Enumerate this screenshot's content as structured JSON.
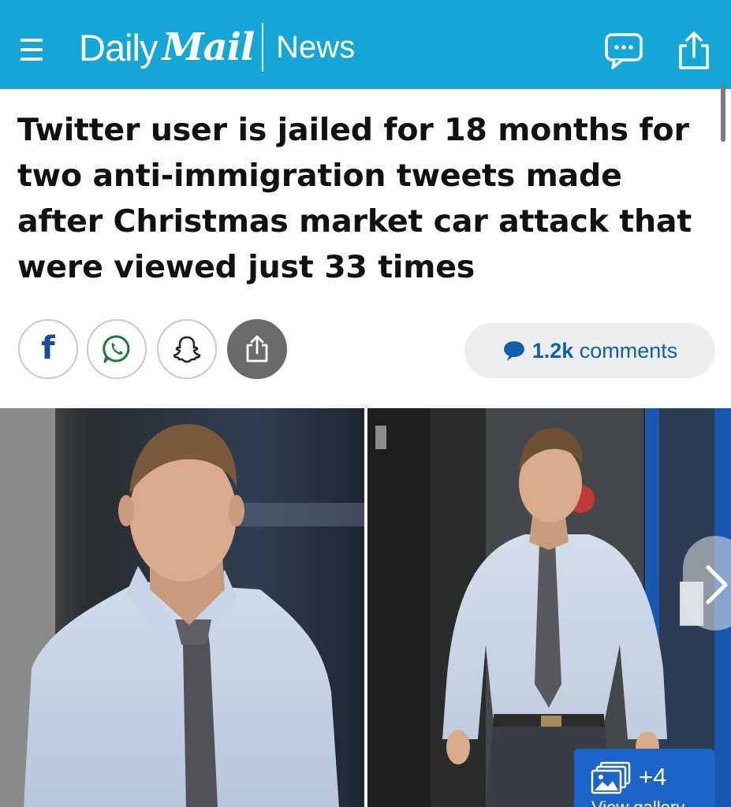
{
  "header": {
    "brand_daily": "Daily",
    "brand_mail": "Mail",
    "section": "News",
    "background": "#13a6d6"
  },
  "article": {
    "headline": "Twitter user is jailed for 18 months for two anti-immigration tweets made after Christmas market car attack that were viewed just 33 times"
  },
  "share": {
    "facebook_glyph": "f",
    "icons": [
      "facebook-icon",
      "whatsapp-icon",
      "snapchat-icon",
      "share-icon"
    ]
  },
  "comments": {
    "count": "1.2k",
    "label": " comments",
    "accent": "#0f5fae"
  },
  "gallery": {
    "count_label": "+4",
    "view_label": "View gallery",
    "badge_color": "#1c64c8"
  }
}
